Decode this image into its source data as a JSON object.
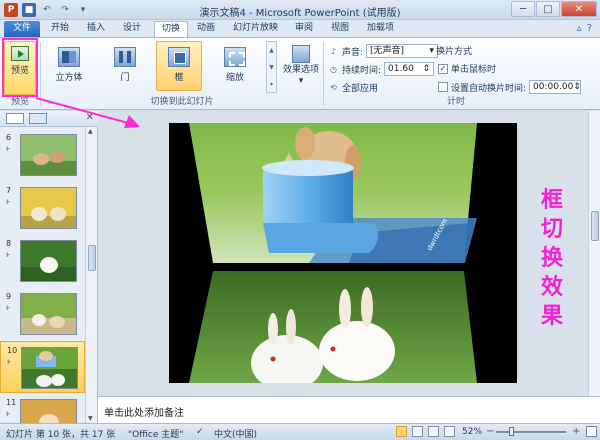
{
  "window": {
    "title": "演示文稿4 - Microsoft PowerPoint (试用版)",
    "controls": {
      "minimize": "─",
      "maximize": "□",
      "close": "✕"
    }
  },
  "quick_access": {
    "app_icon": "P",
    "save_icon": "💾",
    "undo_icon": "↶",
    "redo_icon": "↷",
    "more_icon": "▾"
  },
  "tabs": [
    "文件",
    "开始",
    "插入",
    "设计",
    "切换",
    "动画",
    "幻灯片放映",
    "审阅",
    "视图",
    "加载项"
  ],
  "active_tab": "切换",
  "tab_icons": {
    "minimize_ribbon": "▵",
    "help": "?"
  },
  "ribbon": {
    "preview": {
      "label": "预览",
      "group": "预览"
    },
    "gallery": {
      "group": "切换到此幻灯片",
      "items": [
        {
          "label": "立方体",
          "icon": "cube-icon"
        },
        {
          "label": "门",
          "icon": "door-icon"
        },
        {
          "label": "框",
          "icon": "box-icon",
          "selected": true
        },
        {
          "label": "缩放",
          "icon": "zoom-icon"
        }
      ],
      "scroll": {
        "up": "▲",
        "down": "▼",
        "more": "▾"
      }
    },
    "effect_options": {
      "label1": "效果选项",
      "label2": "▾"
    },
    "timing": {
      "group": "计时",
      "sound_label": "声音:",
      "sound_value": "[无声音]",
      "duration_label": "持续时间:",
      "duration_value": "01.60",
      "apply_all": "全部应用",
      "advance_title": "换片方式",
      "on_click_label": "单击鼠标时",
      "on_click_checked": "✓",
      "after_label": "设置自动换片时间:",
      "after_value": "00:00.00"
    }
  },
  "slides_pane": {
    "close": "✕",
    "scroll": {
      "up": "▲",
      "down": "▼"
    },
    "thumbs": [
      {
        "num": "6",
        "star": "ⱶ"
      },
      {
        "num": "7",
        "star": "ⱶ"
      },
      {
        "num": "8",
        "star": "ⱶ"
      },
      {
        "num": "9",
        "star": "ⱶ"
      },
      {
        "num": "10",
        "star": "ⱶ",
        "selected": true
      },
      {
        "num": "11",
        "star": "ⱶ"
      }
    ]
  },
  "slide": {
    "watermark": "dwrdtcom"
  },
  "caption": [
    "框",
    "切",
    "换",
    "效",
    "果"
  ],
  "notes_placeholder": "单击此处添加备注",
  "status": {
    "slide_info": "幻灯片 第 10 张，共 17 张",
    "theme": "\"Office 主题\"",
    "language": "中文(中国)",
    "zoom": "52%",
    "zoom_minus": "−",
    "zoom_plus": "+",
    "zoom_level": 0.52
  },
  "colors": {
    "accent_pink": "#ee24d4",
    "file_tab": "#2565b8",
    "selection": "#ffd26e"
  }
}
